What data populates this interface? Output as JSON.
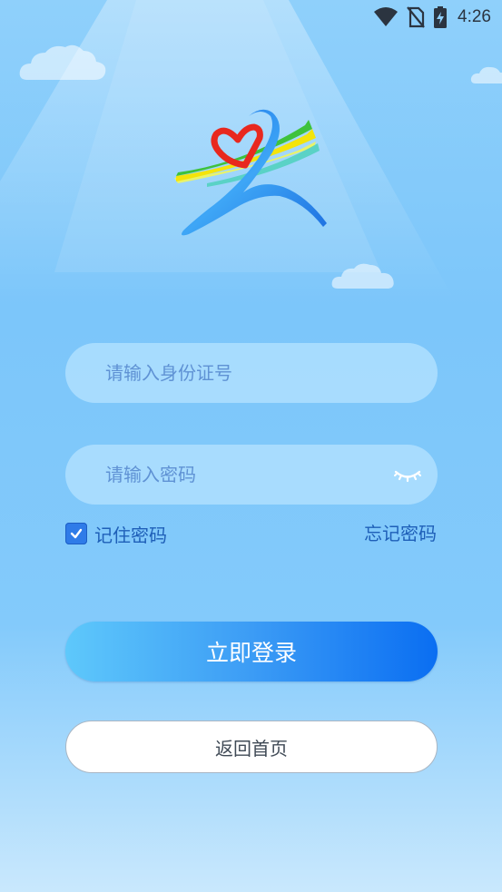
{
  "status_bar": {
    "time": "4:26",
    "icons": [
      "wifi-icon",
      "no-sim-icon",
      "battery-charging-icon"
    ]
  },
  "logo": {
    "icon": "heart-ribbon-figure-logo",
    "colors": {
      "blue": "#2a86f0",
      "red": "#e8281e",
      "yellow": "#f4e40a",
      "green": "#3ec23c",
      "teal": "#52d1c0"
    }
  },
  "form": {
    "id_number": {
      "placeholder": "请输入身份证号",
      "value": ""
    },
    "password": {
      "placeholder": "请输入密码",
      "value": "",
      "toggle_icon": "eye-closed-icon"
    },
    "remember": {
      "label": "记住密码",
      "checked": true
    },
    "forgot_label": "忘记密码",
    "login_label": "立即登录",
    "back_label": "返回首页"
  },
  "colors": {
    "accent": "#1e5fb8",
    "button_start": "#5ec8fb",
    "button_end": "#0a6ef2",
    "background_top": "#8fd0fb",
    "background_bottom": "#c9e8fd"
  }
}
